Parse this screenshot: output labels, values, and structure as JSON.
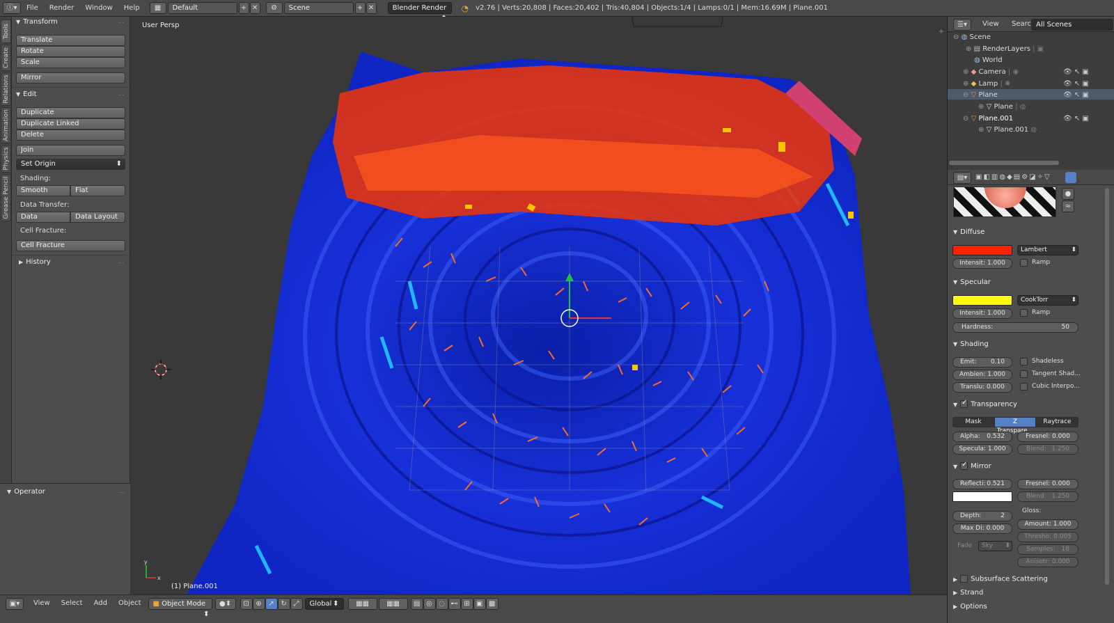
{
  "topbar": {
    "menus": [
      "File",
      "Render",
      "Window",
      "Help"
    ],
    "layout": "Default",
    "scene": "Scene",
    "engine": "Blender Render",
    "stats": "v2.76 | Verts:20,808 | Faces:20,402 | Tris:40,804 | Objects:1/4 | Lamps:0/1 | Mem:16.69M | Plane.001"
  },
  "vtabs": [
    "Tools",
    "Create",
    "Relations",
    "Animation",
    "Physics",
    "Grease Pencil"
  ],
  "toolshelf": {
    "transform_header": "Transform",
    "translate": "Translate",
    "rotate": "Rotate",
    "scale": "Scale",
    "mirror": "Mirror",
    "edit_header": "Edit",
    "duplicate": "Duplicate",
    "duplicate_linked": "Duplicate Linked",
    "delete": "Delete",
    "join": "Join",
    "set_origin": "Set Origin",
    "shading_label": "Shading:",
    "smooth": "Smooth",
    "flat": "Flat",
    "data_transfer_label": "Data Transfer:",
    "data": "Data",
    "data_layout": "Data Layout",
    "cell_fracture_label": "Cell Fracture:",
    "cell_fracture": "Cell Fracture",
    "history_header": "History"
  },
  "operator": {
    "header": "Operator"
  },
  "viewport": {
    "view_label": "User Persp",
    "object_label": "(1) Plane.001"
  },
  "bottombar": {
    "menus": [
      "View",
      "Select",
      "Add",
      "Object"
    ],
    "mode": "Object Mode",
    "orientation": "Global"
  },
  "outliner": {
    "view": "View",
    "search": "Search",
    "scenes": "All Scenes",
    "items": [
      "Scene",
      "RenderLayers",
      "World",
      "Camera",
      "Lamp",
      "Plane",
      "Plane",
      "Plane.001",
      "Plane.001"
    ]
  },
  "properties": {
    "diffuse_header": "Diffuse",
    "diffuse_shader": "Lambert",
    "diffuse_intensity": "Intensit: 1.000",
    "ramp": "Ramp",
    "specular_header": "Specular",
    "specular_shader": "CookTorr",
    "specular_intensity": "Intensit: 1.000",
    "hardness_label": "Hardness:",
    "hardness_value": "50",
    "shading_header": "Shading",
    "emit": "Emit:",
    "emit_value": "0.10",
    "shadeless": "Shadeless",
    "ambient": "Ambien: 1.000",
    "tangent": "Tangent Shad...",
    "translucency": "Translu: 0.000",
    "cubic": "Cubic Interpo...",
    "transparency_header": "Transparency",
    "mask": "Mask",
    "ztransp": "Z Transpare...",
    "raytrace": "Raytrace",
    "alpha": "Alpha:",
    "alpha_value": "0.532",
    "fresnel": "Fresnel: 0.000",
    "specular_val": "Specula: 1.000",
    "blend": "Blend:",
    "blend_value": "1.250",
    "mirror_header": "Mirror",
    "reflect": "Reflecti:",
    "reflect_value": "0.521",
    "mirror_fresnel": "Fresnel: 0.000",
    "mirror_blend": "Blend:",
    "mirror_blend_value": "1.250",
    "gloss_label": "Gloss:",
    "depth": "Depth:",
    "depth_value": "2",
    "amount": "Amount: 1.000",
    "maxdist": "Max Di: 0.000",
    "thresh": "Thresho: 0.005",
    "fade_label": "Fade",
    "fade_value": "Sky",
    "samples": "Samples:",
    "samples_value": "18",
    "aniso": "Anisotr: 0.000",
    "sss": "Subsurface Scattering",
    "strand": "Strand",
    "options": "Options"
  },
  "colors": {
    "diffuse": "#ff2200",
    "specular": "#ffff00",
    "mirror": "#ffffff",
    "ztransp_active": "#5680c2"
  }
}
